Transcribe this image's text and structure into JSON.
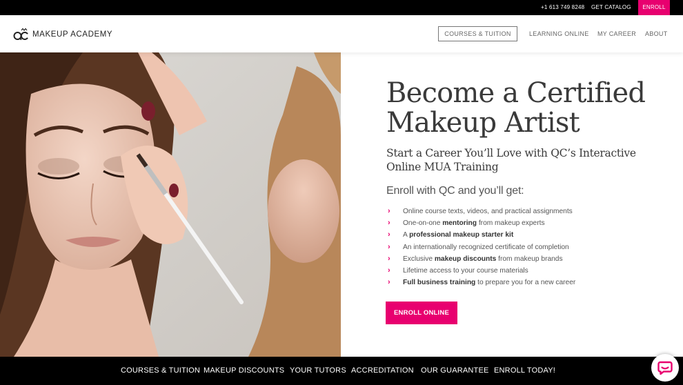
{
  "topbar": {
    "phone": "+1 613 749 8248",
    "catalog": "GET CATALOG",
    "enroll": "ENROLL"
  },
  "header": {
    "logo_text": "MAKEUP ACADEMY",
    "nav": {
      "courses": "COURSES & TUITION",
      "learning": "LEARNING ONLINE",
      "career": "MY CAREER",
      "about": "ABOUT"
    }
  },
  "hero": {
    "title_line1": "Become a Certified",
    "title_line2": "Makeup Artist",
    "subtitle_line1": "Start a Career You’ll Love with QC’s Interactive",
    "subtitle_line2": "Online MUA Training",
    "intro": "Enroll with QC and you’ll get:",
    "benefits": [
      {
        "before": "Online course texts, videos, and practical assignments",
        "bold": "",
        "after": ""
      },
      {
        "before": "One-on-one ",
        "bold": "mentoring",
        "after": " from makeup experts"
      },
      {
        "before": "A ",
        "bold": "professional makeup starter kit",
        "after": ""
      },
      {
        "before": "An internationally recognized certificate of completion",
        "bold": "",
        "after": ""
      },
      {
        "before": "Exclusive ",
        "bold": "makeup discounts",
        "after": " from makeup brands"
      },
      {
        "before": "Lifetime access to your course materials",
        "bold": "",
        "after": ""
      },
      {
        "before": "",
        "bold": "Full business training",
        "after": " to prepare you for a new career"
      }
    ],
    "cta": "ENROLL ONLINE"
  },
  "bottom_nav": {
    "items": [
      "COURSES & TUITION",
      "MAKEUP DISCOUNTS",
      "YOUR TUTORS",
      "ACCREDITATION",
      "OUR GUARANTEE",
      "ENROLL TODAY!"
    ]
  },
  "colors": {
    "accent": "#e8006f",
    "dark": "#000000",
    "text": "#3a3a3a"
  },
  "icons": {
    "chevron": "chevron-right-icon",
    "chat": "chat-bubble-icon"
  }
}
